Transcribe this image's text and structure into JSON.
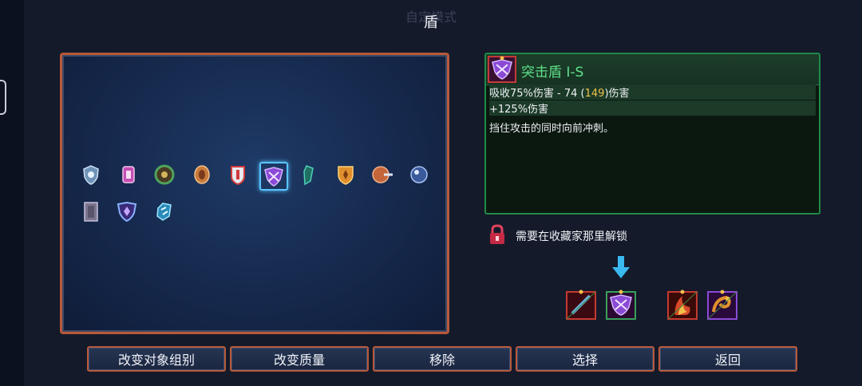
{
  "header": {
    "faded_label": "自定模式",
    "title": "盾"
  },
  "grid": {
    "items": [
      {
        "name": "shield-crest-blue-icon",
        "color": "#8fb6d8"
      },
      {
        "name": "shield-pink-vial-icon",
        "color": "#c64fb5"
      },
      {
        "name": "shield-green-round-icon",
        "color": "#4fa35c"
      },
      {
        "name": "shield-bronze-round-icon",
        "color": "#c97a3c"
      },
      {
        "name": "shield-red-white-icon",
        "color": "#d23a3a"
      },
      {
        "name": "shield-purple-assault-icon",
        "color": "#8a4ad6"
      },
      {
        "name": "shield-teal-thin-icon",
        "color": "#2fa08c"
      },
      {
        "name": "shield-orange-crest-icon",
        "color": "#e0902c"
      },
      {
        "name": "shield-spike-round-icon",
        "color": "#c4663a"
      },
      {
        "name": "shield-blue-orb-icon",
        "color": "#7aa0e0"
      },
      {
        "name": "shield-grey-tower-icon",
        "color": "#7b7690"
      },
      {
        "name": "shield-purple-heraldic-icon",
        "color": "#6a4fd6"
      },
      {
        "name": "shield-ice-crystal-icon",
        "color": "#6ad0f0"
      }
    ],
    "selected_index": 5
  },
  "info": {
    "name": "突击盾 I-S",
    "stat1_prefix": "吸收75%伤害 - 74 (",
    "stat1_highlight": "149",
    "stat1_suffix": ")伤害",
    "stat2": "+125%伤害",
    "description": "挡住攻击的同时向前冲刺。"
  },
  "lock": {
    "text": "需要在收藏家那里解锁"
  },
  "blueprints": [
    {
      "name": "blueprint-red-spear-icon",
      "color": "#c43a30"
    },
    {
      "name": "blueprint-purple-shield-icon",
      "color": "#8a4ad6"
    },
    {
      "name": "blueprint-red-fire-icon",
      "color": "#d84a2a"
    },
    {
      "name": "blueprint-orange-spiral-icon",
      "color": "#e0902c"
    }
  ],
  "buttons": {
    "change_group": "改变对象组别",
    "change_quality": "改变质量",
    "remove": "移除",
    "select": "选择",
    "back": "返回"
  },
  "colors": {
    "panel_border": "#b8593a",
    "accent_green": "#5fe08a",
    "highlight_gold": "#f2c04a",
    "selection_blue": "#59c4ff"
  }
}
